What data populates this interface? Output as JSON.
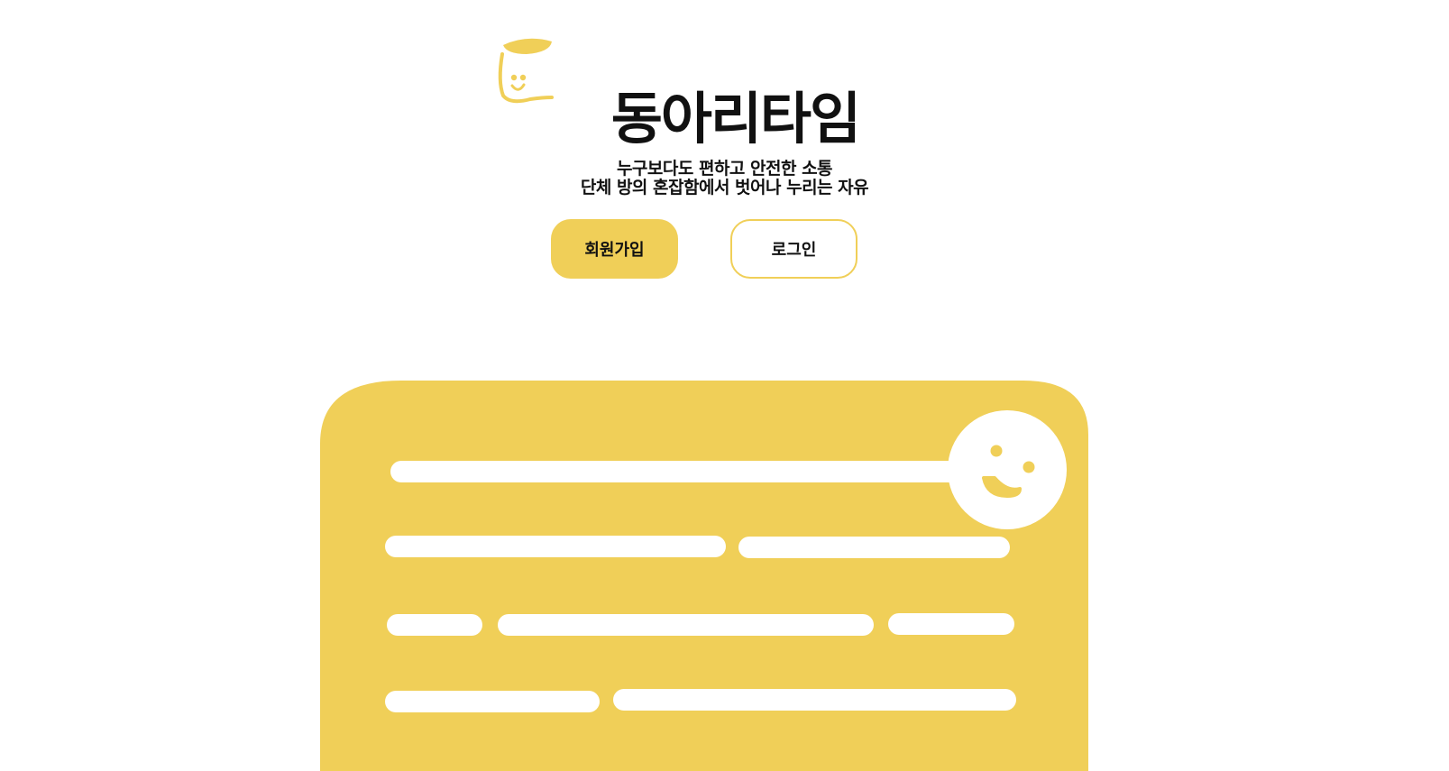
{
  "brand": {
    "title": "동아리타임",
    "tagline_line1": "누구보다도 편하고 안전한 소통",
    "tagline_line2": "단체 방의 혼잡함에서 벗어나 누리는 자유"
  },
  "actions": {
    "signup_label": "회원가입",
    "login_label": "로그인"
  },
  "icons": {
    "logo": "smiling-cup-icon",
    "hero": "chat-bubble-smiley-illustration"
  },
  "colors": {
    "accent": "#f0cf58",
    "text": "#111111",
    "background": "#ffffff"
  }
}
